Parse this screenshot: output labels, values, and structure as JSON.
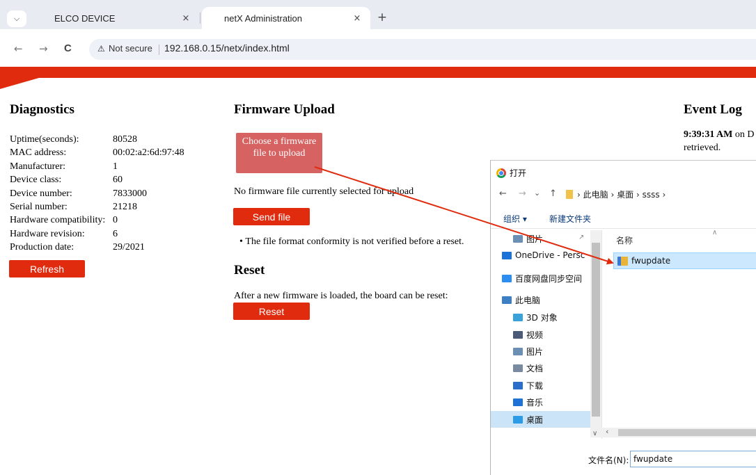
{
  "browser": {
    "tabs": [
      {
        "label": "ELCO DEVICE",
        "active": false
      },
      {
        "label": "netX Administration",
        "active": true
      }
    ],
    "tab_menu_icon": "chevron-down-icon",
    "new_tab_symbol": "+",
    "close_symbol": "×",
    "nav": {
      "back": "←",
      "forward": "→",
      "reload": "C"
    },
    "security_label": "Not secure",
    "url": "192.168.0.15/netx/index.html"
  },
  "colors": {
    "brand_red": "#e02b0f",
    "choose_button": "#d66262",
    "selection_blue": "#cce8ff"
  },
  "diagnostics": {
    "title": "Diagnostics",
    "rows": [
      {
        "label": "Uptime(seconds):",
        "value": "80528"
      },
      {
        "label": "MAC address:",
        "value": "00:02:a2:6d:97:48"
      },
      {
        "label": "Manufacturer:",
        "value": "1"
      },
      {
        "label": "Device class:",
        "value": "60"
      },
      {
        "label": "Device number:",
        "value": "7833000"
      },
      {
        "label": "Serial number:",
        "value": "21218"
      },
      {
        "label": "Hardware compatibility:",
        "value": "0"
      },
      {
        "label": "Hardware revision:",
        "value": "6"
      },
      {
        "label": "Production date:",
        "value": "29/2021"
      }
    ],
    "refresh_label": "Refresh"
  },
  "firmware": {
    "title": "Firmware Upload",
    "choose_label": "Choose a firmware file to upload",
    "status": "No firmware file currently selected for upload",
    "send_label": "Send file",
    "note": "The file format conformity is not verified before a reset."
  },
  "reset": {
    "title": "Reset",
    "text": "After a new firmware is loaded, the board can be reset:",
    "button_label": "Reset"
  },
  "event_log": {
    "title": "Event Log",
    "time": "9:39:31 AM",
    "text_tail": " on D",
    "line2": "retrieved."
  },
  "dialog": {
    "title": "打开",
    "nav_back": "←",
    "nav_forward": "→",
    "nav_dropdown": "⌄",
    "nav_up": "↑",
    "path": [
      "此电脑",
      "桌面",
      "ssss"
    ],
    "path_sep": "›",
    "organize": "组织 ▾",
    "new_folder": "新建文件夹",
    "column_name": "名称",
    "sidebar": [
      {
        "label": "图片",
        "icon": "pictures-icon",
        "color": "#6b8fb5"
      },
      {
        "label": "OneDrive - Persc",
        "icon": "onedrive-icon",
        "color": "#1a73d9"
      },
      {
        "label": "百度网盘同步空间",
        "icon": "baidu-netdisk-icon",
        "color": "#2b8ef0"
      },
      {
        "label": "此电脑",
        "icon": "computer-icon",
        "color": "#3c7fc4"
      },
      {
        "label": "3D 对象",
        "icon": "3d-objects-icon",
        "color": "#3aa2d8"
      },
      {
        "label": "视频",
        "icon": "videos-icon",
        "color": "#4b5a78"
      },
      {
        "label": "图片",
        "icon": "pictures-icon",
        "color": "#6b8fb5"
      },
      {
        "label": "文档",
        "icon": "documents-icon",
        "color": "#7a8aa0"
      },
      {
        "label": "下载",
        "icon": "downloads-icon",
        "color": "#2a6fc9"
      },
      {
        "label": "音乐",
        "icon": "music-icon",
        "color": "#1f73d6"
      },
      {
        "label": "桌面",
        "icon": "desktop-icon",
        "color": "#2d9be6"
      }
    ],
    "file_item": "fwupdate",
    "filename_label": "文件名(N):",
    "filename_value": "fwupdate"
  }
}
